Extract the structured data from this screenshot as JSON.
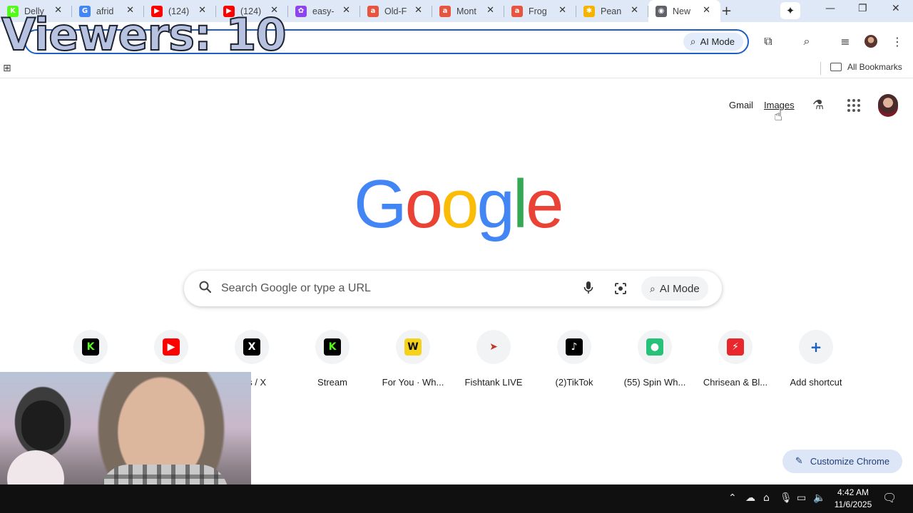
{
  "overlay": {
    "viewers_text": "Viewers: 10"
  },
  "tabs": [
    {
      "title": "Delly",
      "fav_color": "#53fc18",
      "fav_glyph": "K",
      "active": false
    },
    {
      "title": "afrid",
      "fav_color": "#4285f4",
      "fav_glyph": "G",
      "active": false
    },
    {
      "title": "(124)",
      "fav_color": "#ff0000",
      "fav_glyph": "▶",
      "active": false
    },
    {
      "title": "(124)",
      "fav_color": "#ff0000",
      "fav_glyph": "▶",
      "active": false
    },
    {
      "title": "easy-",
      "fav_color": "#8e44ec",
      "fav_glyph": "✿",
      "active": false
    },
    {
      "title": "Old-F",
      "fav_color": "#e8553f",
      "fav_glyph": "a",
      "active": false
    },
    {
      "title": "Mont",
      "fav_color": "#e8553f",
      "fav_glyph": "a",
      "active": false
    },
    {
      "title": "Frog",
      "fav_color": "#e8553f",
      "fav_glyph": "a",
      "active": false
    },
    {
      "title": "Pean",
      "fav_color": "#f5b400",
      "fav_glyph": "✱",
      "active": false
    },
    {
      "title": "New",
      "fav_color": "#5f6368",
      "fav_glyph": "◉",
      "active": true
    }
  ],
  "tab_close_glyph": "✕",
  "new_tab_glyph": "+",
  "gemini_glyph": "✦",
  "window_controls": {
    "minimize": "—",
    "restore": "❐",
    "close": "✕"
  },
  "toolbar": {
    "ai_mode_label": "AI Mode",
    "ai_icon": "⌕",
    "extensions_icon": "puzzle-icon",
    "extensions_glyph": "⧉",
    "tab_search_glyph": "⌕",
    "media_glyph": "≡",
    "menu_glyph": "⋮"
  },
  "bookmarks": {
    "apps_glyph": "⊞",
    "all_label": "All Bookmarks"
  },
  "ntp": {
    "gmail": "Gmail",
    "images": "Images",
    "labs_glyph": "⚗",
    "cursor_glyph": "☝"
  },
  "logo": [
    "G",
    "o",
    "o",
    "g",
    "l",
    "e"
  ],
  "search": {
    "placeholder": "Search Google or type a URL",
    "mic_glyph": "🎤",
    "ai_mode_label": "AI Mode",
    "ai_glyph": "⌕"
  },
  "shortcuts": [
    {
      "label": "",
      "icon_bg": "#000000",
      "icon_fg": "#53fc18",
      "glyph": "K"
    },
    {
      "label": "",
      "icon_bg": "#ff0000",
      "icon_fg": "#ffffff",
      "glyph": "▶"
    },
    {
      "label": "ges / X",
      "icon_bg": "#000000",
      "icon_fg": "#ffffff",
      "glyph": "X"
    },
    {
      "label": "Stream",
      "icon_bg": "#000000",
      "icon_fg": "#53fc18",
      "glyph": "K"
    },
    {
      "label": "For You · Wh...",
      "icon_bg": "#f7d21a",
      "icon_fg": "#111111",
      "glyph": "W"
    },
    {
      "label": "Fishtank LIVE",
      "icon_bg": "#f1f3f4",
      "icon_fg": "#c0392b",
      "glyph": "➤"
    },
    {
      "label": "(2)TikTok",
      "icon_bg": "#000000",
      "icon_fg": "#ffffff",
      "glyph": "♪"
    },
    {
      "label": "(55) Spin Wh...",
      "icon_bg": "#27c27a",
      "icon_fg": "#ffffff",
      "glyph": "●"
    },
    {
      "label": "Chrisean & Bl...",
      "icon_bg": "#e8262b",
      "icon_fg": "#ffffff",
      "glyph": "⚡"
    },
    {
      "label": "Add shortcut",
      "icon_bg": "#f1f3f4",
      "icon_fg": "#1a5ec7",
      "glyph": "+"
    }
  ],
  "customize": {
    "label": "Customize Chrome",
    "glyph": "✎"
  },
  "taskbar": {
    "tray_chevron": "⌃",
    "cloud_glyph": "☁",
    "usb_glyph": "⌂",
    "mic_glyph": "🎙",
    "net_glyph": "▭",
    "vol_glyph": "🔈",
    "time": "4:42 AM",
    "date": "11/6/2025",
    "notif_glyph": "🗨"
  }
}
